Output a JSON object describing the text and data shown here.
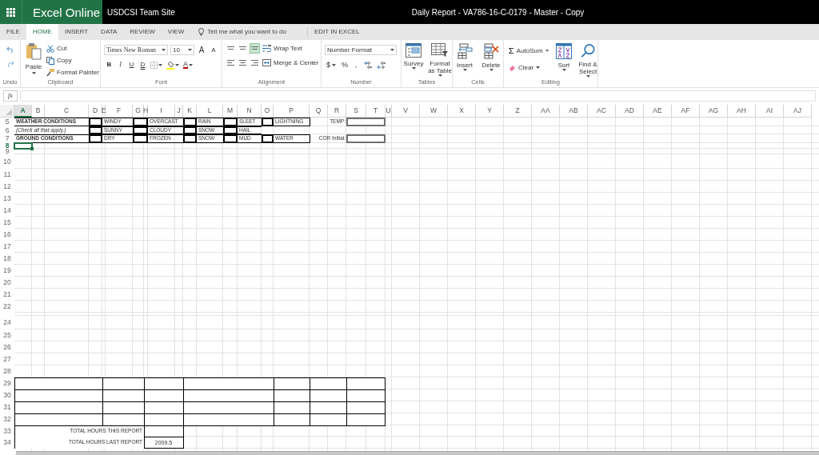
{
  "app": {
    "name": "Excel Online",
    "site": "USDCSI Team Site",
    "document_title": "Daily Report - VA786-16-C-0179 - Master - Copy"
  },
  "tabs": [
    {
      "label": "FILE",
      "selected": false
    },
    {
      "label": "HOME",
      "selected": true
    },
    {
      "label": "INSERT",
      "selected": false
    },
    {
      "label": "DATA",
      "selected": false
    },
    {
      "label": "REVIEW",
      "selected": false
    },
    {
      "label": "VIEW",
      "selected": false
    }
  ],
  "tell_me": {
    "placeholder": "Tell me what you want to do"
  },
  "edit_in_excel": "EDIT IN EXCEL",
  "ribbon": {
    "groups": [
      {
        "kind": "undo",
        "label": "Undo"
      },
      {
        "kind": "clipboard",
        "label": "Clipboard",
        "paste": "Paste",
        "items": [
          "Cut",
          "Copy",
          "Format Painter"
        ]
      },
      {
        "kind": "font",
        "label": "Font",
        "font_name": "Times New Roman",
        "font_size": "10",
        "grow": "A",
        "shrink": "A",
        "styles": [
          "B",
          "I",
          "U",
          "D"
        ],
        "font_color": "A"
      },
      {
        "kind": "alignment",
        "label": "Alignment",
        "vertical": [
          {
            "selected": false
          },
          {
            "selected": false
          },
          {
            "selected": true
          }
        ],
        "wrap": "Wrap Text",
        "merge": "Merge & Center"
      },
      {
        "kind": "number",
        "label": "Number",
        "format": "Number Format",
        "currency": "$",
        "percent": "%",
        "comma": ","
      },
      {
        "kind": "large",
        "label": "Tables",
        "buttons": [
          {
            "label": "Survey"
          },
          {
            "label": "Format as Table"
          }
        ]
      },
      {
        "kind": "large",
        "label": "Cells",
        "buttons": [
          {
            "label": "Insert"
          },
          {
            "label": "Delete"
          }
        ]
      },
      {
        "kind": "editing",
        "label": "Editing",
        "autosum": "AutoSum",
        "clear": "Clear",
        "buttons": [
          {
            "label": "Sort"
          },
          {
            "label": "Find & Select"
          }
        ]
      }
    ]
  },
  "formula_bar": {
    "function_label": "fx"
  },
  "sheet": {
    "columns": [
      {
        "label": "A",
        "selected": true
      },
      {
        "label": "B",
        "selected": false
      },
      {
        "label": "C",
        "selected": false
      },
      {
        "label": "D",
        "selected": false
      },
      {
        "label": "E",
        "selected": false
      },
      {
        "label": "F",
        "selected": false
      },
      {
        "label": "G",
        "selected": false
      },
      {
        "label": "H",
        "selected": false
      },
      {
        "label": "I",
        "selected": false
      },
      {
        "label": "J",
        "selected": false
      },
      {
        "label": "K",
        "selected": false
      },
      {
        "label": "L",
        "selected": false
      },
      {
        "label": "M",
        "selected": false
      },
      {
        "label": "N",
        "selected": false
      },
      {
        "label": "O",
        "selected": false
      },
      {
        "label": "P",
        "selected": false
      },
      {
        "label": "Q",
        "selected": false
      },
      {
        "label": "R",
        "selected": false
      },
      {
        "label": "S",
        "selected": false
      },
      {
        "label": "T",
        "selected": false
      },
      {
        "label": "U",
        "selected": false
      },
      {
        "label": "V",
        "selected": false
      },
      {
        "label": "W",
        "selected": false
      },
      {
        "label": "X",
        "selected": false
      },
      {
        "label": "Y",
        "selected": false
      },
      {
        "label": "Z",
        "selected": false
      },
      {
        "label": "AA",
        "selected": false
      },
      {
        "label": "AB",
        "selected": false
      },
      {
        "label": "AC",
        "selected": false
      },
      {
        "label": "AD",
        "selected": false
      },
      {
        "label": "AE",
        "selected": false
      },
      {
        "label": "AF",
        "selected": false
      },
      {
        "label": "AG",
        "selected": false
      },
      {
        "label": "AH",
        "selected": false
      },
      {
        "label": "AI",
        "selected": false
      },
      {
        "label": "AJ",
        "selected": false
      }
    ],
    "rows": [
      {
        "label": "5",
        "selected": false
      },
      {
        "label": "6",
        "selected": false
      },
      {
        "label": "7",
        "selected": false
      },
      {
        "label": "8",
        "selected": true
      },
      {
        "label": "9",
        "selected": false
      },
      {
        "label": "10",
        "selected": false
      },
      {
        "label": "11",
        "selected": false
      },
      {
        "label": "12",
        "selected": false
      },
      {
        "label": "13",
        "selected": false
      },
      {
        "label": "14",
        "selected": false
      },
      {
        "label": "15",
        "selected": false
      },
      {
        "label": "16",
        "selected": false
      },
      {
        "label": "17",
        "selected": false
      },
      {
        "label": "18",
        "selected": false
      },
      {
        "label": "19",
        "selected": false
      },
      {
        "label": "20",
        "selected": false
      },
      {
        "label": "21",
        "selected": false
      },
      {
        "label": "22",
        "selected": false
      },
      {
        "label": "24",
        "selected": false
      },
      {
        "label": "25",
        "selected": false
      },
      {
        "label": "26",
        "selected": false
      },
      {
        "label": "27",
        "selected": false
      },
      {
        "label": "28",
        "selected": false
      },
      {
        "label": "29",
        "selected": false
      },
      {
        "label": "30",
        "selected": false
      },
      {
        "label": "31",
        "selected": false
      },
      {
        "label": "32",
        "selected": false
      },
      {
        "label": "33",
        "selected": false
      },
      {
        "label": "34",
        "selected": false
      }
    ],
    "conditions": [
      {
        "label": "WEATHER CONDITIONS",
        "bold": true,
        "italic": false,
        "options": [
          {
            "text": "WINDY",
            "checked": false
          },
          {
            "text": "OVERCAST",
            "checked": false
          },
          {
            "text": "RAIN",
            "checked": false
          },
          {
            "text": "SLEET",
            "checked": false
          },
          {
            "text": "LIGHTNING",
            "checked": false
          }
        ],
        "field": "TEMP:"
      },
      {
        "label": "(Check all that apply.)",
        "bold": false,
        "italic": true,
        "options": [
          {
            "text": "SUNNY",
            "checked": false
          },
          {
            "text": "CLOUDY",
            "checked": false
          },
          {
            "text": "SNOW",
            "checked": false
          },
          {
            "text": "HAIL",
            "checked": false
          }
        ]
      },
      {
        "label": "GROUND CONDITIONS",
        "bold": true,
        "italic": false,
        "options": [
          {
            "text": "DRY",
            "checked": false
          },
          {
            "text": "FROZEN",
            "checked": false
          },
          {
            "text": "SNOW",
            "checked": false
          },
          {
            "text": "MUD",
            "checked": false
          },
          {
            "text": "WATER",
            "checked": false
          }
        ],
        "field": "COR Initial:"
      }
    ],
    "totals": [
      {
        "label": "TOTAL HOURS THIS REPORT"
      },
      {
        "label": "TOTAL HOURS LAST REPORT",
        "value": "2009.5"
      }
    ]
  }
}
